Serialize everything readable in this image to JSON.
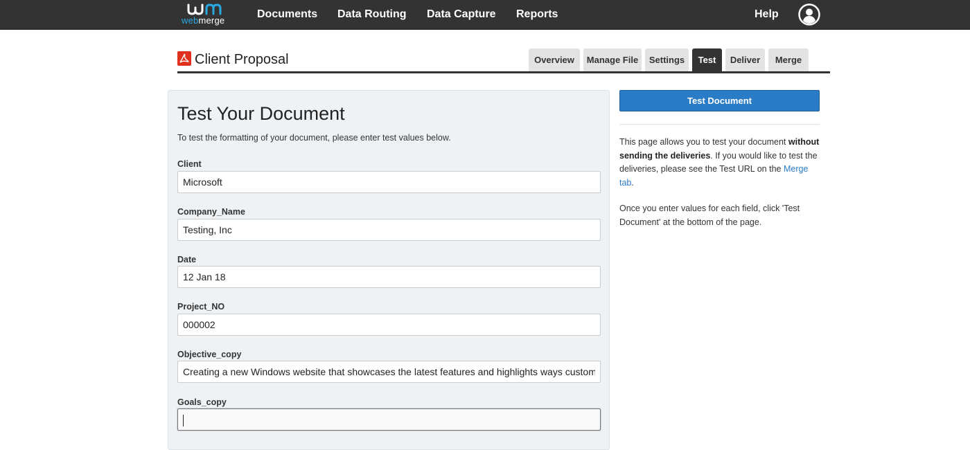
{
  "nav": {
    "logo_text_1": "web",
    "logo_text_2": "merge",
    "items": [
      {
        "label": "Documents"
      },
      {
        "label": "Data Routing"
      },
      {
        "label": "Data Capture"
      },
      {
        "label": "Reports"
      }
    ],
    "help_label": "Help",
    "colors": {
      "bar": "#333333",
      "logo_accent": "#2aa9e0"
    }
  },
  "document": {
    "title": "Client Proposal",
    "icon": "pdf-icon"
  },
  "tabs": [
    {
      "label": "Overview",
      "active": false
    },
    {
      "label": "Manage File",
      "active": false
    },
    {
      "label": "Settings",
      "active": false
    },
    {
      "label": "Test",
      "active": true
    },
    {
      "label": "Deliver",
      "active": false
    },
    {
      "label": "Merge",
      "active": false
    }
  ],
  "form": {
    "heading": "Test Your Document",
    "intro": "To test the formatting of your document, please enter test values below.",
    "fields": [
      {
        "label": "Client",
        "value": "Microsoft"
      },
      {
        "label": "Company_Name",
        "value": "Testing, Inc"
      },
      {
        "label": "Date",
        "value": "12 Jan 18"
      },
      {
        "label": "Project_NO",
        "value": "000002"
      },
      {
        "label": "Objective_copy",
        "value": "Creating a new Windows website that showcases the latest features and highlights ways custom"
      },
      {
        "label": "Goals_copy",
        "value": ""
      }
    ]
  },
  "sidebar": {
    "test_button_label": "Test Document",
    "para1_a": "This page allows you to test your document ",
    "para1_bold": "without sending the deliveries",
    "para1_b": ". If you would like to test the deliveries, please see the Test URL on the ",
    "para1_link": "Merge tab",
    "para1_c": ".",
    "para2": "Once you enter values for each field, click 'Test Document' at the bottom of the page.",
    "colors": {
      "button": "#2a7cc7",
      "link": "#2a7cc7"
    }
  }
}
